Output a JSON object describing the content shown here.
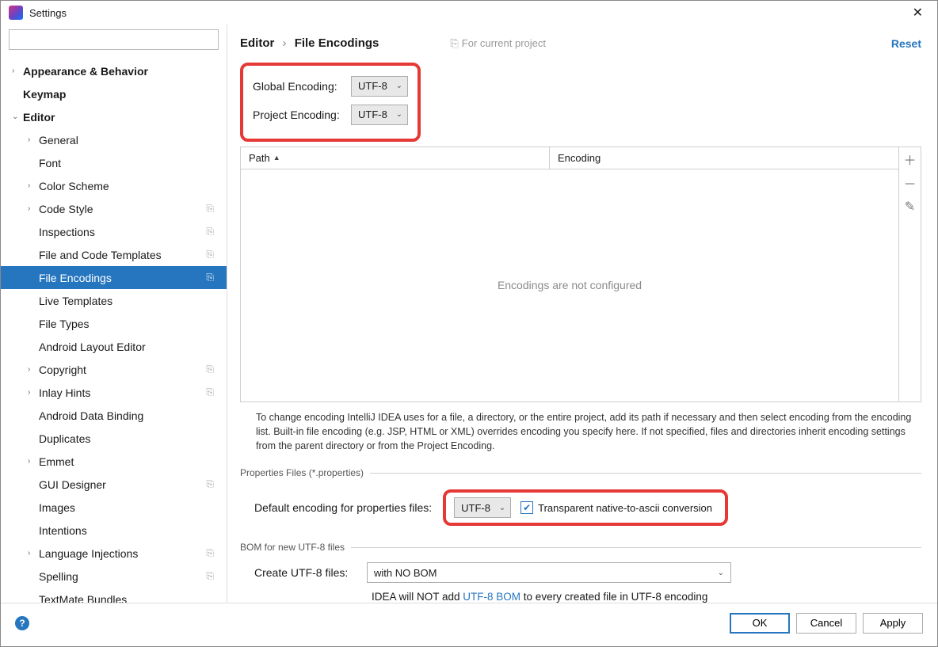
{
  "title": "Settings",
  "search_placeholder": "",
  "tree": [
    {
      "label": "Appearance & Behavior",
      "level": 1,
      "arrow": "›",
      "bold": true
    },
    {
      "label": "Keymap",
      "level": 1,
      "arrow": "",
      "bold": true
    },
    {
      "label": "Editor",
      "level": 1,
      "arrow": "⌄",
      "bold": true,
      "expanded": true
    },
    {
      "label": "General",
      "level": 2,
      "arrow": "›"
    },
    {
      "label": "Font",
      "level": 2,
      "arrow": ""
    },
    {
      "label": "Color Scheme",
      "level": 2,
      "arrow": "›"
    },
    {
      "label": "Code Style",
      "level": 2,
      "arrow": "›",
      "copy": true
    },
    {
      "label": "Inspections",
      "level": 2,
      "arrow": "",
      "copy": true
    },
    {
      "label": "File and Code Templates",
      "level": 2,
      "arrow": "",
      "copy": true
    },
    {
      "label": "File Encodings",
      "level": 2,
      "arrow": "",
      "copy": true,
      "selected": true
    },
    {
      "label": "Live Templates",
      "level": 2,
      "arrow": ""
    },
    {
      "label": "File Types",
      "level": 2,
      "arrow": ""
    },
    {
      "label": "Android Layout Editor",
      "level": 2,
      "arrow": ""
    },
    {
      "label": "Copyright",
      "level": 2,
      "arrow": "›",
      "copy": true
    },
    {
      "label": "Inlay Hints",
      "level": 2,
      "arrow": "›",
      "copy": true
    },
    {
      "label": "Android Data Binding",
      "level": 2,
      "arrow": ""
    },
    {
      "label": "Duplicates",
      "level": 2,
      "arrow": ""
    },
    {
      "label": "Emmet",
      "level": 2,
      "arrow": "›"
    },
    {
      "label": "GUI Designer",
      "level": 2,
      "arrow": "",
      "copy": true
    },
    {
      "label": "Images",
      "level": 2,
      "arrow": ""
    },
    {
      "label": "Intentions",
      "level": 2,
      "arrow": ""
    },
    {
      "label": "Language Injections",
      "level": 2,
      "arrow": "›",
      "copy": true
    },
    {
      "label": "Spelling",
      "level": 2,
      "arrow": "",
      "copy": true
    },
    {
      "label": "TextMate Bundles",
      "level": 2,
      "arrow": ""
    }
  ],
  "breadcrumb": {
    "parent": "Editor",
    "current": "File Encodings"
  },
  "for_current": "For current project",
  "reset": "Reset",
  "global_encoding_label": "Global Encoding:",
  "global_encoding_value": "UTF-8",
  "project_encoding_label": "Project Encoding:",
  "project_encoding_value": "UTF-8",
  "table": {
    "path_col": "Path",
    "encoding_col": "Encoding",
    "empty": "Encodings are not configured"
  },
  "help_text": "To change encoding IntelliJ IDEA uses for a file, a directory, or the entire project, add its path if necessary and then select encoding from the encoding list. Built-in file encoding (e.g. JSP, HTML or XML) overrides encoding you specify here. If not specified, files and directories inherit encoding settings from the parent directory or from the Project Encoding.",
  "props_section": "Properties Files (*.properties)",
  "props_label": "Default encoding for properties files:",
  "props_value": "UTF-8",
  "transparent_label": "Transparent native-to-ascii conversion",
  "bom_section": "BOM for new UTF-8 files",
  "bom_label": "Create UTF-8 files:",
  "bom_value": "with NO BOM",
  "bom_note_prefix": "IDEA will NOT add ",
  "bom_note_link": "UTF-8 BOM",
  "bom_note_suffix": " to every created file in UTF-8 encoding",
  "buttons": {
    "ok": "OK",
    "cancel": "Cancel",
    "apply": "Apply"
  }
}
